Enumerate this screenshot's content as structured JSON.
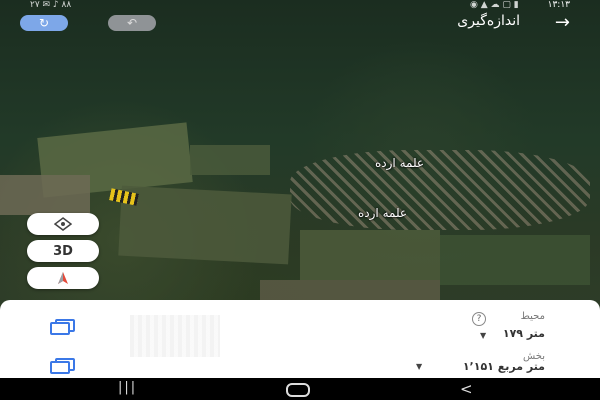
{
  "status_bar": {
    "time": "۱۳:۱۳",
    "left_text": "۲۷ ✉ ♪ ۸۸",
    "icons_text": "◉ ▲ ☁ ▢ ▮"
  },
  "toolbar": {
    "title": "اندازه‌گیری",
    "back_icon": "arrow-right-icon",
    "redo_icon": "redo-icon",
    "undo_icon": "undo-icon"
  },
  "map": {
    "labels": [
      "علمه ارده",
      "علمه ارده"
    ]
  },
  "controls": {
    "compass_icon": "compass-icon",
    "view_3d_label": "3D",
    "layer_icon": "location-pin-icon"
  },
  "measurements": {
    "perimeter_label": "محیط",
    "perimeter_value": "۱۷۹ متر",
    "area_label": "بخش",
    "area_value": "۱٬۱۵۱ متر مربع"
  },
  "navbar": {
    "recent": "|||",
    "back": "<"
  },
  "colors": {
    "accent": "#7da7e8",
    "sheet": "#ffffff"
  }
}
